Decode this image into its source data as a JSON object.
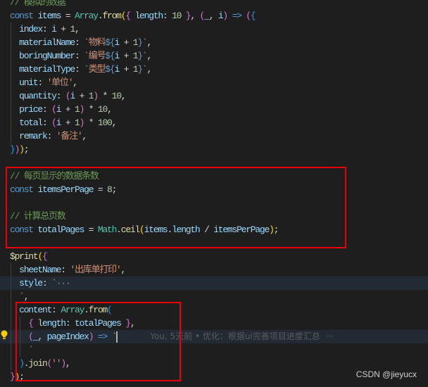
{
  "code_lines": [
    {
      "tokens": [
        [
          "// 模拟的数据",
          "cm"
        ]
      ]
    },
    {
      "tokens": [
        [
          "const ",
          "kw"
        ],
        [
          "items",
          "var"
        ],
        [
          " = ",
          "op"
        ],
        [
          "Array",
          "cls"
        ],
        [
          ".",
          "op"
        ],
        [
          "from",
          "fn"
        ],
        [
          "(",
          "b1"
        ],
        [
          "{",
          "b2"
        ],
        [
          " length",
          "var"
        ],
        [
          ": ",
          "op"
        ],
        [
          "10",
          "num"
        ],
        [
          " }",
          "b2"
        ],
        [
          ", ",
          "op"
        ],
        [
          "(",
          "b2"
        ],
        [
          "_",
          "var"
        ],
        [
          ", ",
          "op"
        ],
        [
          "i",
          "var"
        ],
        [
          ")",
          "b2"
        ],
        [
          " => ",
          "kw"
        ],
        [
          "(",
          "b2"
        ],
        [
          "{",
          "b3"
        ]
      ],
      "guides": []
    },
    {
      "tokens": [
        [
          "  index",
          "var"
        ],
        [
          ": ",
          "op"
        ],
        [
          "i",
          "var"
        ],
        [
          " + ",
          "op"
        ],
        [
          "1",
          "num"
        ],
        [
          ",",
          "op"
        ]
      ],
      "guides": [
        1
      ]
    },
    {
      "tokens": [
        [
          "  materialName",
          "var"
        ],
        [
          ": ",
          "op"
        ],
        [
          "`物料",
          "str"
        ],
        [
          "${",
          "tpl"
        ],
        [
          "i",
          "var"
        ],
        [
          " + ",
          "op"
        ],
        [
          "1",
          "num"
        ],
        [
          "}",
          "tpl"
        ],
        [
          "`",
          "str"
        ],
        [
          ",",
          "op"
        ]
      ],
      "guides": [
        1
      ]
    },
    {
      "tokens": [
        [
          "  boringNumber",
          "var"
        ],
        [
          ": ",
          "op"
        ],
        [
          "`编号",
          "str"
        ],
        [
          "${",
          "tpl"
        ],
        [
          "i",
          "var"
        ],
        [
          " + ",
          "op"
        ],
        [
          "1",
          "num"
        ],
        [
          "}",
          "tpl"
        ],
        [
          "`",
          "str"
        ],
        [
          ",",
          "op"
        ]
      ],
      "guides": [
        1
      ]
    },
    {
      "tokens": [
        [
          "  materialType",
          "var"
        ],
        [
          ": ",
          "op"
        ],
        [
          "`类型",
          "str"
        ],
        [
          "${",
          "tpl"
        ],
        [
          "i",
          "var"
        ],
        [
          " + ",
          "op"
        ],
        [
          "1",
          "num"
        ],
        [
          "}",
          "tpl"
        ],
        [
          "`",
          "str"
        ],
        [
          ",",
          "op"
        ]
      ],
      "guides": [
        1
      ]
    },
    {
      "tokens": [
        [
          "  unit",
          "var"
        ],
        [
          ": ",
          "op"
        ],
        [
          "'单位'",
          "str"
        ],
        [
          ",",
          "op"
        ]
      ],
      "guides": [
        1
      ]
    },
    {
      "tokens": [
        [
          "  quantity",
          "var"
        ],
        [
          ": ",
          "op"
        ],
        [
          "(",
          "b2"
        ],
        [
          "i",
          "var"
        ],
        [
          " + ",
          "op"
        ],
        [
          "1",
          "num"
        ],
        [
          ")",
          "b2"
        ],
        [
          " * ",
          "op"
        ],
        [
          "10",
          "num"
        ],
        [
          ",",
          "op"
        ]
      ],
      "guides": [
        1
      ]
    },
    {
      "tokens": [
        [
          "  price",
          "var"
        ],
        [
          ": ",
          "op"
        ],
        [
          "(",
          "b2"
        ],
        [
          "i",
          "var"
        ],
        [
          " + ",
          "op"
        ],
        [
          "1",
          "num"
        ],
        [
          ")",
          "b2"
        ],
        [
          " * ",
          "op"
        ],
        [
          "10",
          "num"
        ],
        [
          ",",
          "op"
        ]
      ],
      "guides": [
        1
      ]
    },
    {
      "tokens": [
        [
          "  total",
          "var"
        ],
        [
          ": ",
          "op"
        ],
        [
          "(",
          "b2"
        ],
        [
          "i",
          "var"
        ],
        [
          " + ",
          "op"
        ],
        [
          "1",
          "num"
        ],
        [
          ")",
          "b2"
        ],
        [
          " * ",
          "op"
        ],
        [
          "100",
          "num"
        ],
        [
          ",",
          "op"
        ]
      ],
      "guides": [
        1
      ]
    },
    {
      "tokens": [
        [
          "  remark",
          "var"
        ],
        [
          ": ",
          "op"
        ],
        [
          "'备注'",
          "str"
        ],
        [
          ",",
          "op"
        ]
      ],
      "guides": [
        1
      ]
    },
    {
      "tokens": [
        [
          "}",
          "b3"
        ],
        [
          ")",
          "b2"
        ],
        [
          ")",
          "b1"
        ],
        [
          ";",
          "op"
        ]
      ]
    },
    {
      "tokens": []
    },
    {
      "tokens": [
        [
          "// 每页显示的数据条数",
          "cm"
        ]
      ]
    },
    {
      "tokens": [
        [
          "const ",
          "kw"
        ],
        [
          "itemsPerPage",
          "var"
        ],
        [
          " = ",
          "op"
        ],
        [
          "8",
          "num"
        ],
        [
          ";",
          "op"
        ]
      ]
    },
    {
      "tokens": []
    },
    {
      "tokens": [
        [
          "// 计算总页数",
          "cm"
        ]
      ]
    },
    {
      "tokens": [
        [
          "const ",
          "kw"
        ],
        [
          "totalPages",
          "var"
        ],
        [
          " = ",
          "op"
        ],
        [
          "Math",
          "cls"
        ],
        [
          ".",
          "op"
        ],
        [
          "ceil",
          "fn"
        ],
        [
          "(",
          "b1"
        ],
        [
          "items",
          "var"
        ],
        [
          ".",
          "op"
        ],
        [
          "length",
          "var"
        ],
        [
          " / ",
          "op"
        ],
        [
          "itemsPerPage",
          "var"
        ],
        [
          ")",
          "b1"
        ],
        [
          ";",
          "op"
        ]
      ]
    },
    {
      "tokens": []
    },
    {
      "tokens": [
        [
          "$print",
          "fn"
        ],
        [
          "(",
          "b1"
        ],
        [
          "{",
          "b2"
        ]
      ]
    },
    {
      "tokens": [
        [
          "  sheetName",
          "var"
        ],
        [
          ": ",
          "op"
        ],
        [
          "'出库单打印'",
          "str"
        ],
        [
          ",",
          "op"
        ]
      ],
      "guides": [
        1
      ]
    },
    {
      "tokens": [
        [
          "  style",
          "var"
        ],
        [
          ": ",
          "op"
        ],
        [
          "`",
          "str"
        ],
        [
          "···",
          "cm2"
        ]
      ],
      "guides": [
        1
      ],
      "highlight": true
    },
    {
      "tokens": [
        [
          "  `",
          "str"
        ],
        [
          ",",
          "op"
        ]
      ],
      "guides": [
        1
      ]
    },
    {
      "tokens": [
        [
          "  content",
          "var"
        ],
        [
          ": ",
          "op"
        ],
        [
          "Array",
          "cls"
        ],
        [
          ".",
          "op"
        ],
        [
          "from",
          "fn"
        ],
        [
          "(",
          "b3"
        ]
      ],
      "guides": [
        1
      ]
    },
    {
      "tokens": [
        [
          "    {",
          "b2"
        ],
        [
          " length",
          "var"
        ],
        [
          ": ",
          "op"
        ],
        [
          "totalPages",
          "var"
        ],
        [
          " }",
          "b2"
        ],
        [
          ",",
          "op"
        ]
      ],
      "guides": [
        1,
        2
      ]
    },
    {
      "tokens": [
        [
          "    (",
          "b2"
        ],
        [
          "_",
          "var"
        ],
        [
          ", ",
          "op"
        ],
        [
          "pageIndex",
          "var"
        ],
        [
          ")",
          "b2"
        ],
        [
          " => ",
          "kw"
        ],
        [
          "`",
          "str"
        ]
      ],
      "guides": [
        1,
        2
      ],
      "highlight": true,
      "cursor": true,
      "blame": "You, 5天前 • 优化：根据ui完善项目进度汇总  ···"
    },
    {
      "tokens": [
        [
          "    `",
          "str"
        ]
      ],
      "guides": [
        1,
        2
      ]
    },
    {
      "tokens": [
        [
          "  )",
          "b3"
        ],
        [
          ".",
          "op"
        ],
        [
          "join",
          "fn"
        ],
        [
          "(",
          "b2"
        ],
        [
          "''",
          "str"
        ],
        [
          ")",
          "b2"
        ],
        [
          ",",
          "op"
        ]
      ],
      "guides": [
        1
      ]
    },
    {
      "tokens": [
        [
          "}",
          "b2"
        ],
        [
          ")",
          "b1"
        ],
        [
          ";",
          "op"
        ]
      ]
    }
  ],
  "watermark": "CSDN @jieyucx",
  "colors": {
    "background": "#1e1e1e",
    "highlight_box": "#e8000b"
  }
}
